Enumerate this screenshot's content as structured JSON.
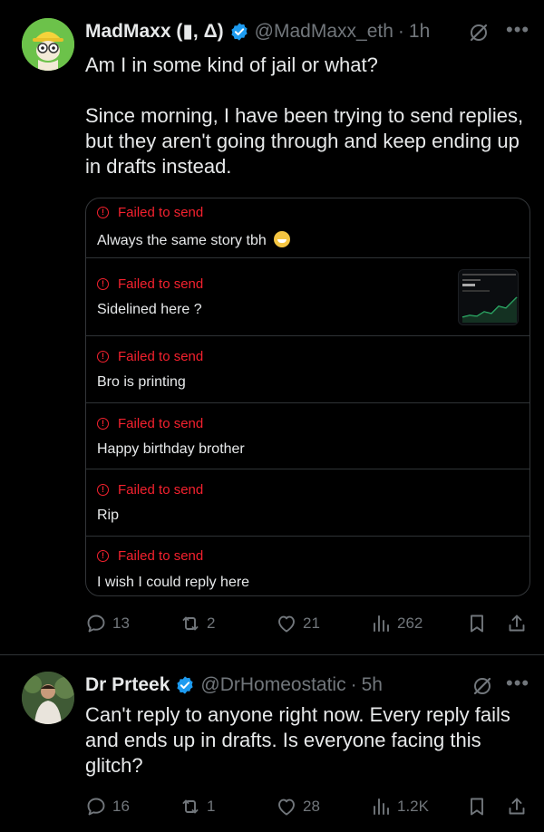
{
  "tweet1": {
    "name": "MadMaxx (▮, Δ)",
    "handle": "@MadMaxx_eth",
    "separator": "·",
    "time": "1h",
    "text": "Am I in some kind of jail or what?\n\nSince morning, I have been trying to send replies, but they aren't going through and keep ending up in drafts instead.",
    "drafts": [
      {
        "status": "Failed to send",
        "text": "Always the same story tbh",
        "emoji": "grinning-face"
      },
      {
        "status": "Failed to send",
        "text": "Sidelined here ?"
      },
      {
        "status": "Failed to send",
        "text": "Bro is printing"
      },
      {
        "status": "Failed to send",
        "text": "Happy birthday brother"
      },
      {
        "status": "Failed to send",
        "text": "Rip"
      },
      {
        "status": "Failed to send",
        "text": "I wish I could reply here"
      }
    ],
    "stats": {
      "replies": "13",
      "reposts": "2",
      "likes": "21",
      "views": "262"
    }
  },
  "tweet2": {
    "name": "Dr Prteek",
    "handle": "@DrHomeostatic",
    "separator": "·",
    "time": "5h",
    "text": "Can't reply to anyone right now. Every reply fails and ends up in drafts. Is everyone facing this glitch?",
    "stats": {
      "replies": "16",
      "reposts": "1",
      "likes": "28",
      "views": "1.2K"
    }
  },
  "icons": {
    "verified": "verified-badge-icon",
    "grok": "grok-icon",
    "more": "more-icon",
    "reply": "reply-icon",
    "repost": "repost-icon",
    "like": "like-icon",
    "views": "views-icon",
    "bookmark": "bookmark-icon",
    "share": "share-icon",
    "failed": "failed-alert-icon"
  },
  "colors": {
    "background": "#000000",
    "text": "#e7e9ea",
    "muted": "#71767b",
    "verified": "#1d9bf0",
    "error": "#f4212e",
    "border": "#2f3336"
  }
}
